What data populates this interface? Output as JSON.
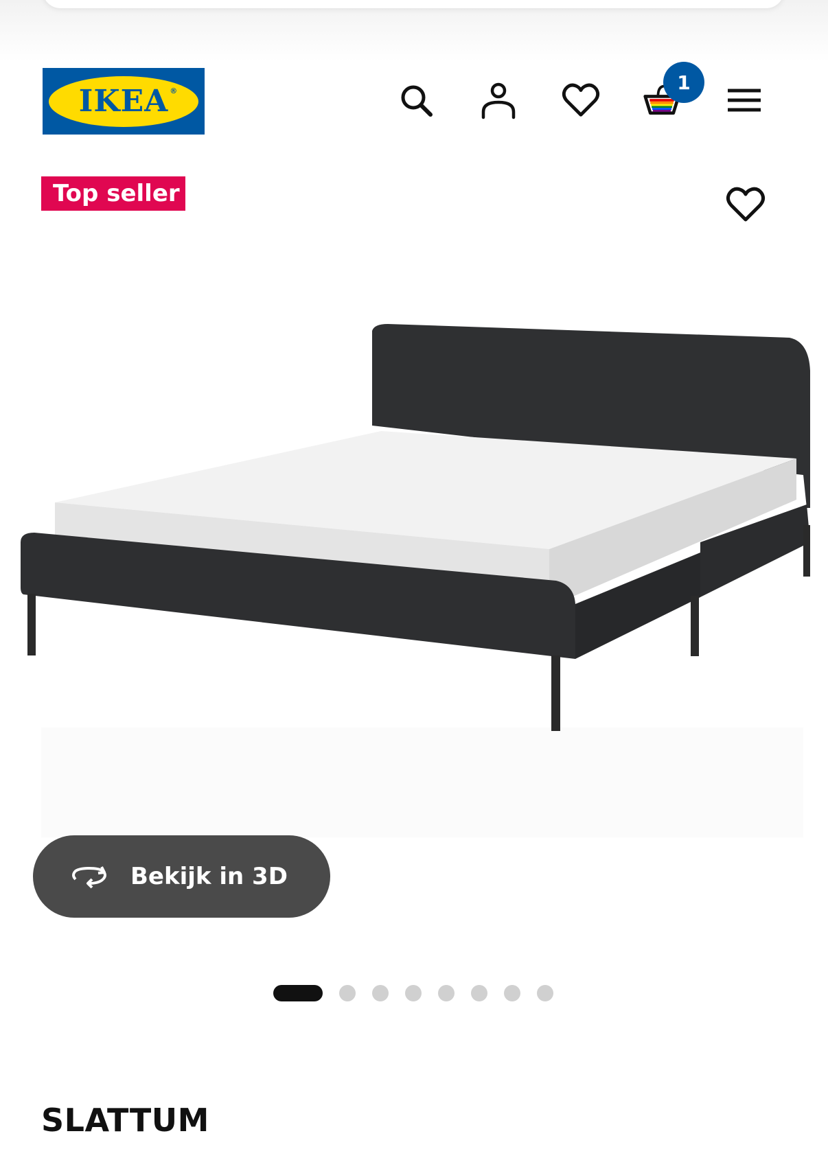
{
  "header": {
    "logo_text": "IKEA",
    "logo_registered": "®",
    "icons": [
      "search-icon",
      "account-icon",
      "favorites-icon",
      "cart-icon",
      "menu-icon"
    ],
    "cart_count": "1"
  },
  "product": {
    "badge": "Top seller",
    "name": "SLATTUM",
    "subtitle": "",
    "view_3d_label": "Bekijk in 3D",
    "image_count": 8,
    "active_image": 1
  },
  "colors": {
    "ikea_blue": "#0058a3",
    "ikea_yellow": "#ffdb00",
    "badge_pink": "#e00751",
    "button_gray": "#4a4a4a"
  }
}
